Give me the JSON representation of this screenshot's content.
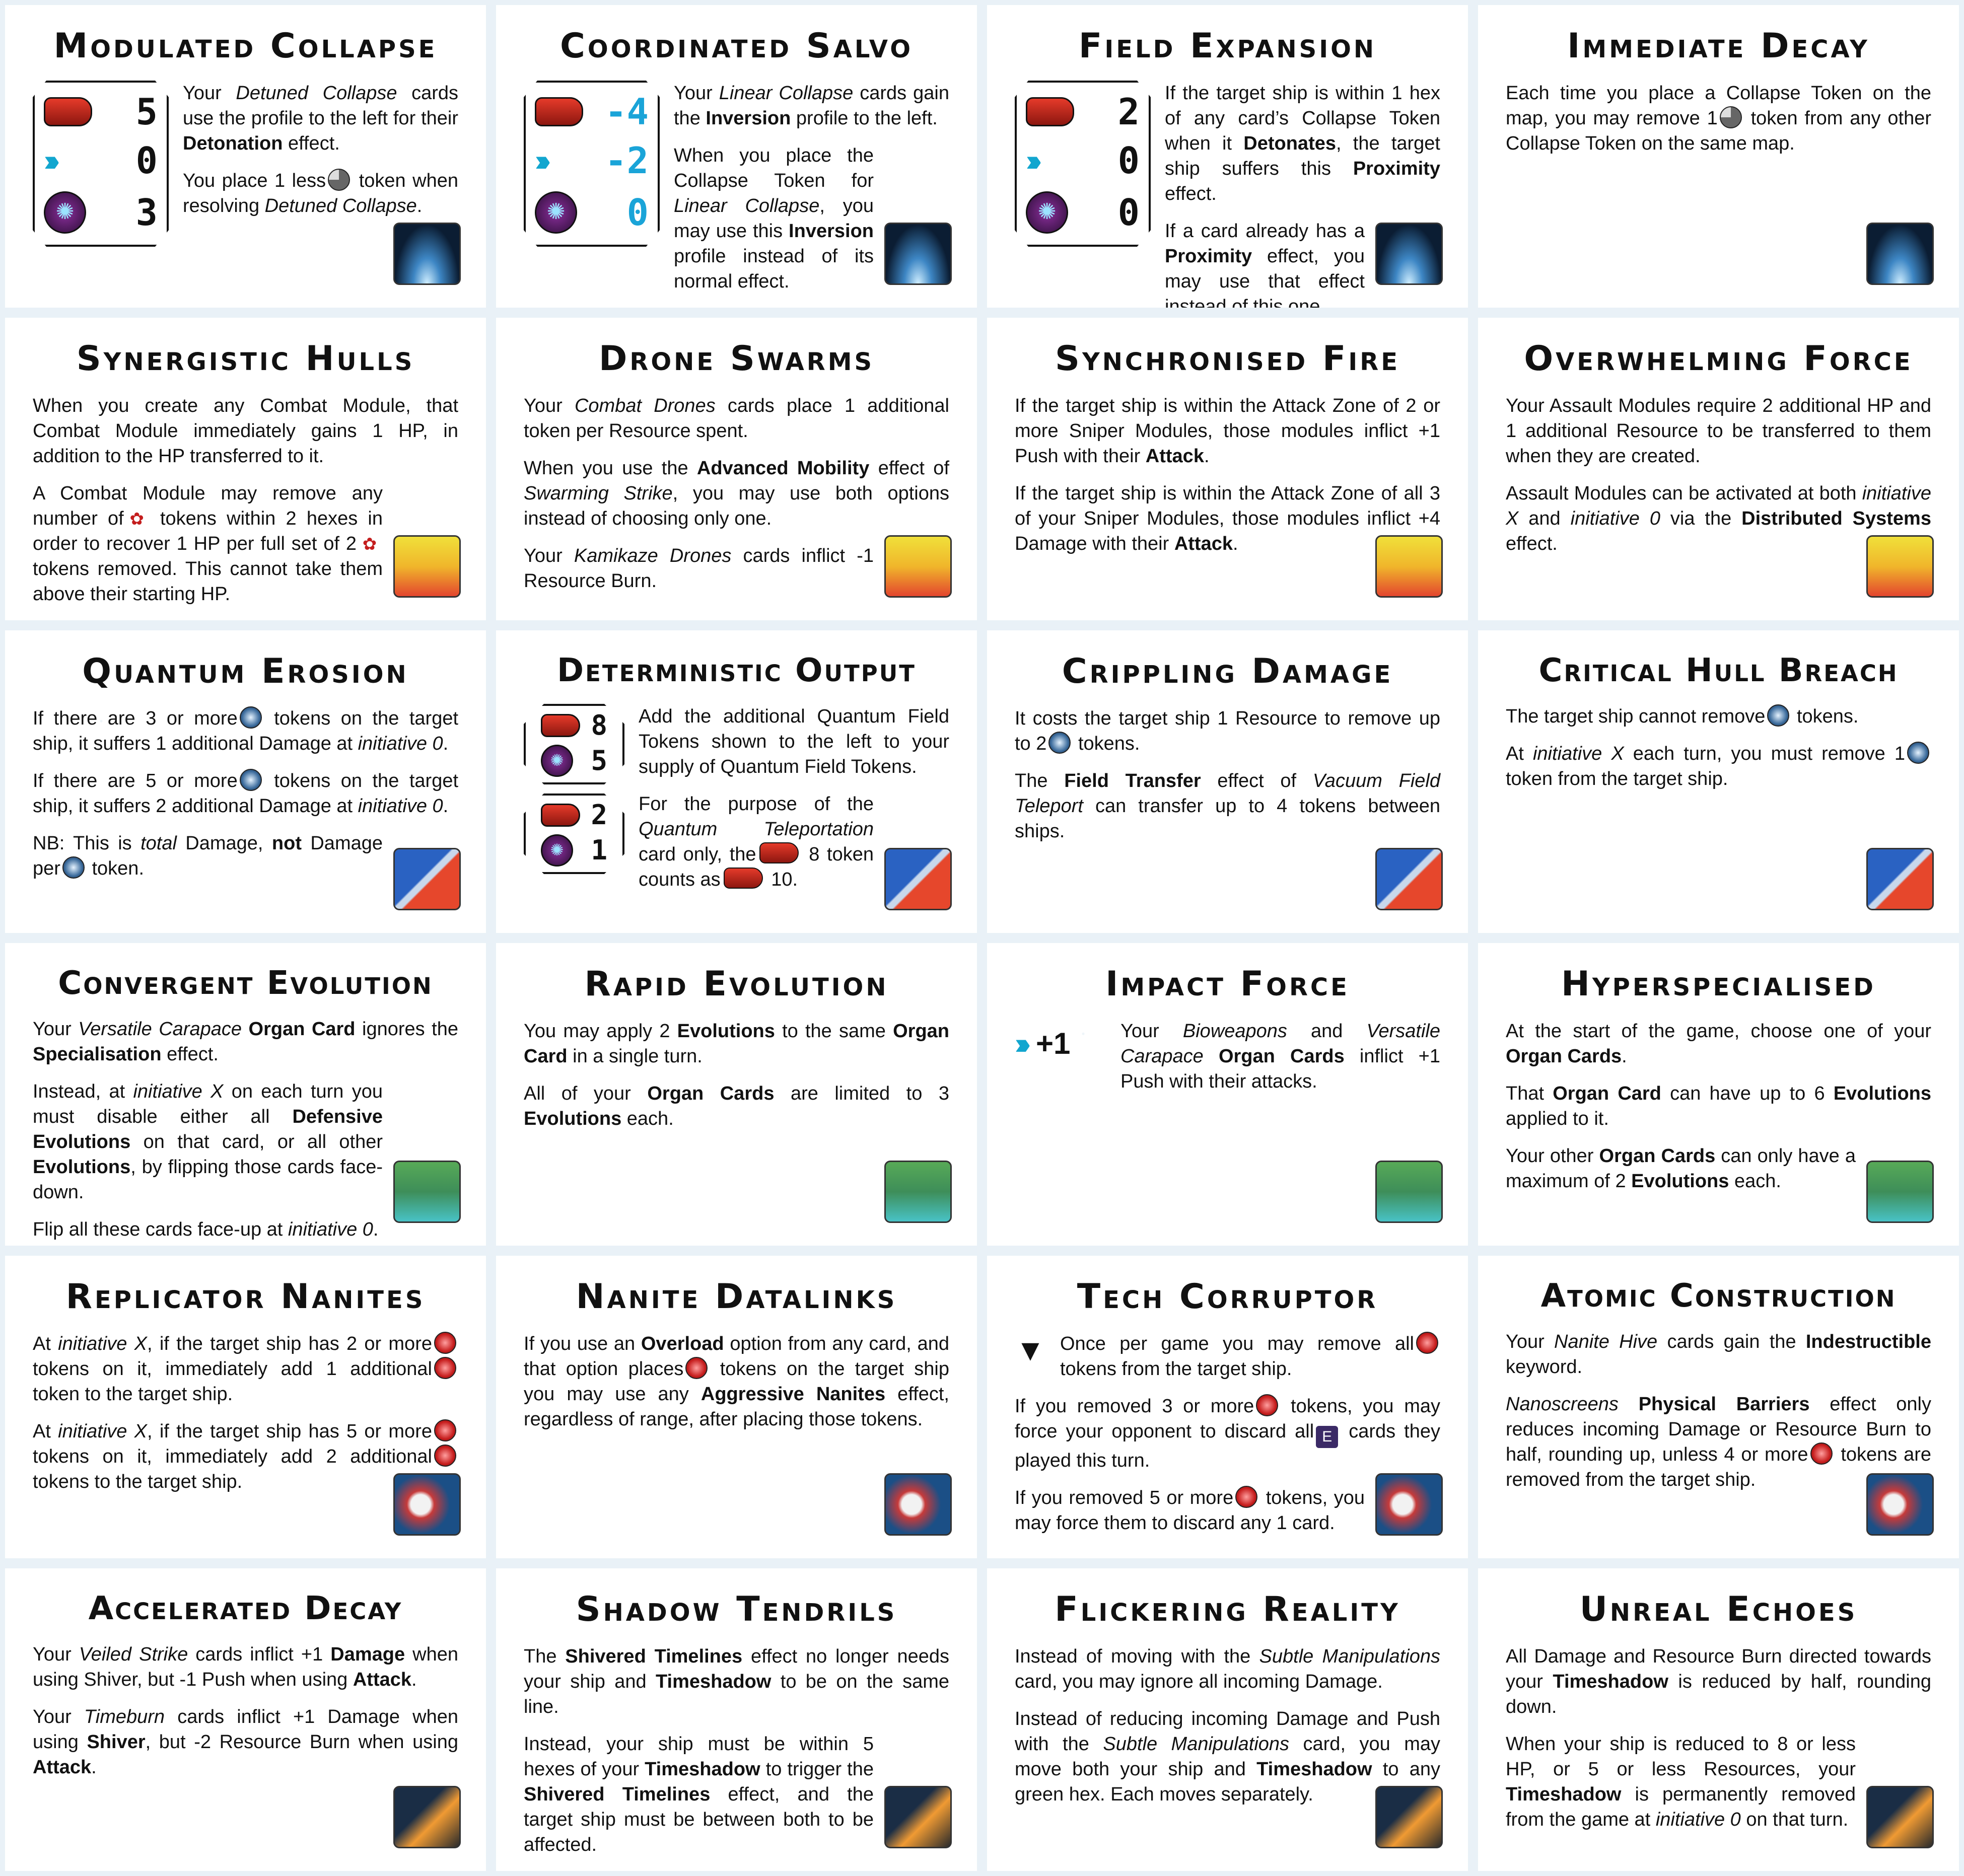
{
  "cards": [
    {
      "title": "Modulated Collapse",
      "emblem": "collapse-emblem-icon"
    },
    {
      "title": "Coordinated Salvo",
      "emblem": "collapse-emblem-icon"
    },
    {
      "title": "Field Expansion",
      "emblem": "collapse-emblem-icon"
    },
    {
      "title": "Immediate Decay",
      "emblem": "collapse-emblem-icon"
    },
    {
      "title": "Synergistic Hulls",
      "emblem": "combat-emblem-icon"
    },
    {
      "title": "Drone Swarms",
      "emblem": "combat-emblem-icon"
    },
    {
      "title": "Synchronised Fire",
      "emblem": "combat-emblem-icon"
    },
    {
      "title": "Overwhelming Force",
      "emblem": "combat-emblem-icon"
    },
    {
      "title": "Quantum Erosion",
      "emblem": "quantum-emblem-icon"
    },
    {
      "title": "Deterministic Output",
      "emblem": "quantum-emblem-icon"
    },
    {
      "title": "Crippling Damage",
      "emblem": "quantum-emblem-icon"
    },
    {
      "title": "Critical Hull Breach",
      "emblem": "quantum-emblem-icon"
    },
    {
      "title": "Convergent Evolution",
      "emblem": "evolution-emblem-icon"
    },
    {
      "title": "Rapid Evolution",
      "emblem": "evolution-emblem-icon"
    },
    {
      "title": "Impact Force",
      "emblem": "evolution-emblem-icon"
    },
    {
      "title": "Hyperspecialised",
      "emblem": "evolution-emblem-icon"
    },
    {
      "title": "Replicator Nanites",
      "emblem": "nanite-emblem-icon"
    },
    {
      "title": "Nanite Datalinks",
      "emblem": "nanite-emblem-icon"
    },
    {
      "title": "Tech Corruptor",
      "emblem": "nanite-emblem-icon"
    },
    {
      "title": "Atomic Construction",
      "emblem": "nanite-emblem-icon"
    },
    {
      "title": "Accelerated Decay",
      "emblem": "shadow-emblem-icon"
    },
    {
      "title": "Shadow Tendrils",
      "emblem": "shadow-emblem-icon"
    },
    {
      "title": "Flickering Reality",
      "emblem": "shadow-emblem-icon"
    },
    {
      "title": "Unreal Echoes",
      "emblem": "shadow-emblem-icon"
    }
  ],
  "text": {
    "c0": {
      "profile": [
        "5",
        "0",
        "3"
      ],
      "p1a": "Your ",
      "p1b": "Detuned Collapse",
      "p1c": " cards use the profile to the left for their ",
      "p1d": "Detonation",
      "p1e": " effect.",
      "p2a": "You place 1 less",
      "p2b": " token when resolving ",
      "p2c": "Detuned Collapse",
      "p2d": "."
    },
    "c1": {
      "profile": [
        "-4",
        "-2",
        "0"
      ],
      "p1a": "Your ",
      "p1b": "Linear Collapse",
      "p1c": " cards gain the ",
      "p1d": "Inversion",
      "p1e": " profile to the left.",
      "p2a": "When you place the Collapse Token for ",
      "p2b": "Linear Collapse",
      "p2c": ", you may use this ",
      "p2d": "Inversion",
      "p2e": " profile instead of its normal effect."
    },
    "c2": {
      "profile": [
        "2",
        "0",
        "0"
      ],
      "p1a": "If the target ship is within 1 hex of any card’s Collapse Token when it ",
      "p1b": "Detonates",
      "p1c": ", the target ship suffers this ",
      "p1d": "Proximity",
      "p1e": " effect.",
      "p2a": "If a card already has a ",
      "p2b": "Proximity",
      "p2c": " effect, you may use that effect instead of this one."
    },
    "c3": {
      "p1a": "Each time you place a Collapse Token on the map, you may remove 1",
      "p1b": " token from any other Collapse Token on the same map."
    },
    "c4": {
      "p1": "When you create any Combat Module, that Combat Module immediately gains 1 HP, in addition to the HP transferred to it.",
      "p2a": "A Combat Module may remove any number of",
      "p2b": " tokens within 2 hexes in order to recover 1 HP per full set of 2",
      "p2c": " tokens removed. This cannot take them above their starting HP."
    },
    "c5": {
      "p1a": "Your ",
      "p1b": "Combat Drones",
      "p1c": " cards place 1 additional token per Resource spent.",
      "p2a": "When you use the ",
      "p2b": "Advanced Mobility",
      "p2c": " effect of ",
      "p2d": "Swarming Strike",
      "p2e": ", you may use both options instead of choosing only one.",
      "p3a": "Your ",
      "p3b": "Kamikaze Drones",
      "p3c": " cards inflict -1 Resource Burn."
    },
    "c6": {
      "p1a": "If the target ship is within the Attack Zone of 2 or more Sniper Modules, those modules inflict +1 Push with their ",
      "p1b": "Attack",
      "p1c": ".",
      "p2a": "If the target ship is within the Attack Zone of all 3 of your Sniper Modules, those modules inflict +4 Damage with their ",
      "p2b": "Attack",
      "p2c": "."
    },
    "c7": {
      "p1": "Your Assault Modules require 2 additional HP and 1 additional Resource to be transferred to them when they are created.",
      "p2a": "Assault Modules can be activated at both ",
      "p2b": "initiative X",
      "p2c": " and ",
      "p2d": "initiative 0",
      "p2e": " via the ",
      "p2f": "Distributed Systems",
      "p2g": " effect."
    },
    "c8": {
      "p1a": "If there are 3 or more",
      "p1b": " tokens on the target ship, it suffers 1 additional Damage at ",
      "p1c": "initiative 0",
      "p1d": ".",
      "p2a": "If there are 5 or more",
      "p2b": " tokens on the target ship, it suffers 2 additional Damage at ",
      "p2c": "initiative 0",
      "p2d": ".",
      "p3a": "NB: This is ",
      "p3b": "total",
      "p3c": " Damage, ",
      "p3d": "not",
      "p3e": " Damage per",
      "p3f": " token."
    },
    "c9": {
      "hex1": [
        "8",
        "5"
      ],
      "hex2": [
        "2",
        "1"
      ],
      "p1": "Add the additional Quantum Field Tokens shown to the left to your supply of Quantum Field Tokens.",
      "p2a": "For the purpose of the ",
      "p2b": "Quantum Teleportation",
      "p2c": " card only, the",
      "p2d": " 8 token counts as",
      "p2e": " 10."
    },
    "c10": {
      "p1a": "It costs the target ship 1 Resource to remove up to 2",
      "p1b": " tokens.",
      "p2a": "The ",
      "p2b": "Field Transfer",
      "p2c": " effect of ",
      "p2d": "Vacuum Field Teleport",
      "p2e": " can transfer up to 4 tokens between ships."
    },
    "c11": {
      "p1a": "The target ship cannot remove",
      "p1b": " tokens.",
      "p2a": "At ",
      "p2b": "initiative X",
      "p2c": " each turn, you must remove 1",
      "p2d": " token from the target ship."
    },
    "c12": {
      "p1a": "Your ",
      "p1b": "Versatile Carapace",
      "p1c": " ",
      "p1d": "Organ Card",
      "p1e": " ignores the ",
      "p1f": "Specialisation",
      "p1g": " effect.",
      "p2a": "Instead, at ",
      "p2b": "initiative X",
      "p2c": " on each turn you must disable either all ",
      "p2d": "Defensive Evolutions",
      "p2e": " on that card, or all other ",
      "p2f": "Evolutions",
      "p2g": ", by flipping those cards face-down.",
      "p3a": "Flip all these cards face-up at ",
      "p3b": "initiative 0",
      "p3c": "."
    },
    "c13": {
      "p1a": "You may apply 2 ",
      "p1b": "Evolutions",
      "p1c": " to the same ",
      "p1d": "Organ Card",
      "p1e": " in a single turn.",
      "p2a": "All of your ",
      "p2b": "Organ Cards",
      "p2c": " are limited to 3 ",
      "p2d": "Evolutions",
      "p2e": " each."
    },
    "c14": {
      "plus": "+1",
      "p1a": "Your ",
      "p1b": "Bioweapons",
      "p1c": " and ",
      "p1d": "Versatile Carapace",
      "p1e": " ",
      "p1f": "Organ Cards",
      "p1g": " inflict +1 Push with their attacks."
    },
    "c15": {
      "p1a": "At the start of the game, choose one of your ",
      "p1b": "Organ Cards",
      "p1c": ".",
      "p2a": "That ",
      "p2b": "Organ Card",
      "p2c": " can have up to 6 ",
      "p2d": "Evolutions",
      "p2e": " applied to it.",
      "p3a": "Your other ",
      "p3b": "Organ Cards",
      "p3c": " can only have a maximum of 2 ",
      "p3d": "Evolutions",
      "p3e": " each."
    },
    "c16": {
      "p1a": "At ",
      "p1b": "initiative X",
      "p1c": ", if the target ship has 2 or more",
      "p1d": " tokens on it, immediately add 1 additional",
      "p1e": " token to the target ship.",
      "p2a": "At ",
      "p2b": "initiative X",
      "p2c": ", if the target ship has 5 or more",
      "p2d": " tokens on it, immediately add 2 additional",
      "p2e": " tokens to the target ship."
    },
    "c17": {
      "p1a": "If you use an ",
      "p1b": "Overload",
      "p1c": " option from any card, and that option places",
      "p1d": " tokens on the target ship you may use any ",
      "p1e": "Aggressive Nanites",
      "p1f": " effect, regardless of range, after placing those tokens."
    },
    "c18": {
      "p1a": "Once per game you may remove all",
      "p1b": " tokens from the target ship.",
      "p2a": "If you removed 3 or more",
      "p2b": " tokens, you may force your opponent to discard all",
      "p2c": " cards they played this turn.",
      "p3a": "If you removed 5 or more",
      "p3b": " tokens, you may force them to discard any 1 card."
    },
    "c19": {
      "p1a": "Your ",
      "p1b": "Nanite Hive",
      "p1c": " cards gain the ",
      "p1d": "Indestructible",
      "p1e": " keyword.",
      "p2a": "Nanoscreens",
      "p2b": " ",
      "p2c": "Physical Barriers",
      "p2d": " effect only reduces incoming Damage or Resource Burn to half, rounding up, unless 4 or more",
      "p2e": " tokens are removed from the target ship."
    },
    "c20": {
      "p1a": "Your ",
      "p1b": "Veiled Strike",
      "p1c": " cards inflict +1 ",
      "p1d": "Damage",
      "p1e": " when using Shiver, but -1 Push when using ",
      "p1f": "Attack",
      "p1g": ".",
      "p2a": "Your ",
      "p2b": "Timeburn",
      "p2c": " cards inflict +1 Damage when using ",
      "p2d": "Shiver",
      "p2e": ", but -2 Resource Burn when using ",
      "p2f": "Attack",
      "p2g": "."
    },
    "c21": {
      "p1a": "The ",
      "p1b": "Shivered Timelines",
      "p1c": " effect no longer needs your ship and ",
      "p1d": "Timeshadow",
      "p1e": " to be on the same line.",
      "p2a": "Instead, your ship must be within 5 hexes of your ",
      "p2b": "Timeshadow",
      "p2c": " to trigger the ",
      "p2d": "Shivered Timelines",
      "p2e": " effect, and the target ship must be between both to be affected."
    },
    "c22": {
      "p1a": "Instead of moving with the ",
      "p1b": "Subtle Manipulations",
      "p1c": " card, you may ignore all incoming Damage.",
      "p2a": "Instead of reducing incoming Damage and Push with the ",
      "p2b": "Subtle Manipulations",
      "p2c": " card, you may move both your ship and ",
      "p2d": "Timeshadow",
      "p2e": " to any green hex. Each moves separately."
    },
    "c23": {
      "p1a": "All Damage and Resource Burn directed towards your ",
      "p1b": "Timeshadow",
      "p1c": " is reduced by half, rounding down.",
      "p2a": "When your ship is reduced to 8 or less HP, or 5 or less Resources, your ",
      "p2b": "Timeshadow",
      "p2c": " is permanently removed from the game at ",
      "p2d": "initiative 0",
      "p2e": " on that turn."
    }
  }
}
